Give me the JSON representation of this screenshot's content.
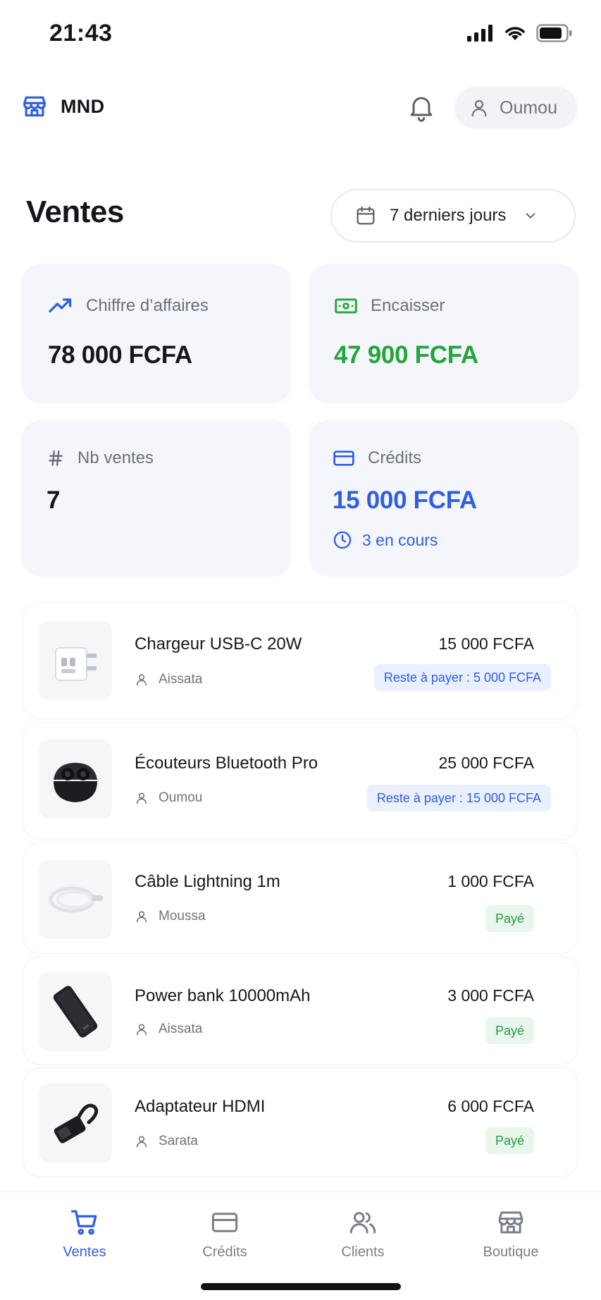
{
  "status_bar": {
    "time": "21:43"
  },
  "header": {
    "brand": "MND",
    "user": "Oumou"
  },
  "page": {
    "title": "Ventes",
    "period": "7 derniers jours"
  },
  "stats": {
    "revenue": {
      "label": "Chiffre d’affaires",
      "value": "78 000 FCFA"
    },
    "collected": {
      "label": "Encaisser",
      "value": "47 900 FCFA",
      "color": "#22a63b"
    },
    "count": {
      "label": "Nb ventes",
      "value": "7"
    },
    "credits": {
      "label": "Crédits",
      "value": "15 000 FCFA",
      "sub": "3 en cours",
      "color": "#2f5fe0"
    }
  },
  "sales": [
    {
      "product": "Chargeur USB-C 20W",
      "customer": "Aissata",
      "price": "15 000 FCFA",
      "status": "Reste à payer : 5 000 FCFA",
      "status_type": "due",
      "thumb_icon": "usb-charger-icon"
    },
    {
      "product": "Écouteurs Bluetooth Pro",
      "customer": "Oumou",
      "price": "25 000 FCFA",
      "status": "Reste à payer : 15 000 FCFA",
      "status_type": "due",
      "thumb_icon": "earbuds-icon"
    },
    {
      "product": "Câble Lightning 1m",
      "customer": "Moussa",
      "price": "1 000 FCFA",
      "status": "Payé",
      "status_type": "paid",
      "thumb_icon": "cable-icon"
    },
    {
      "product": "Power bank 10000mAh",
      "customer": "Aissata",
      "price": "3 000 FCFA",
      "status": "Payé",
      "status_type": "paid",
      "thumb_icon": "power-bank-icon"
    },
    {
      "product": "Adaptateur HDMI",
      "customer": "Sarata",
      "price": "6 000 FCFA",
      "status": "Payé",
      "status_type": "paid",
      "thumb_icon": "hdmi-adapter-icon"
    }
  ],
  "bottom_nav": [
    {
      "label": "Ventes",
      "icon": "cart-icon",
      "active": true
    },
    {
      "label": "Crédits",
      "icon": "card-icon",
      "active": false
    },
    {
      "label": "Clients",
      "icon": "users-icon",
      "active": false
    },
    {
      "label": "Boutique",
      "icon": "store-icon",
      "active": false
    }
  ],
  "colors": {
    "accent": "#2f5fe0",
    "success": "#22a63b",
    "card_bg": "#f4f6fb"
  }
}
